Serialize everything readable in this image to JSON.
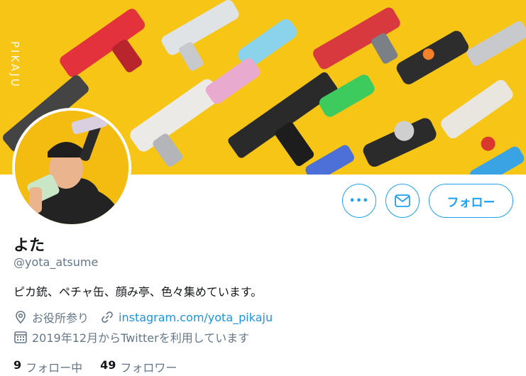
{
  "banner": {
    "watermark": "PIKAJU"
  },
  "actions": {
    "more_label": "•••",
    "follow_label": "フォロー"
  },
  "profile": {
    "name": "よた",
    "handle": "@yota_atsume",
    "bio": "ピカ銃、ペチャ缶、顔み亭、色々集めています。",
    "location": "お役所参り",
    "website": "instagram.com/yota_pikaju",
    "joined": "2019年12月からTwitterを利用しています"
  },
  "stats": {
    "following_count": "9",
    "following_label": "フォロー中",
    "followers_count": "49",
    "followers_label": "フォロワー"
  },
  "colors": {
    "accent": "#1da1f2",
    "banner": "#f7c516",
    "text_secondary": "#657786"
  },
  "icons": {
    "location": "location-pin-icon",
    "link": "link-icon",
    "calendar": "calendar-icon",
    "mail": "mail-icon",
    "more": "more-dots-icon"
  }
}
